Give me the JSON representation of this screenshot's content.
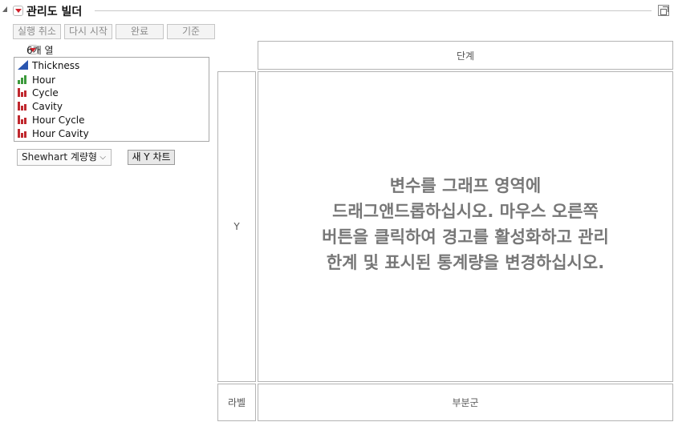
{
  "header": {
    "title": "관리도 빌더"
  },
  "toolbar": {
    "undo_label": "실행 취소",
    "restart_label": "다시 시작",
    "done_label": "완료",
    "criteria_label": "기준"
  },
  "columns": {
    "count_label": "6개 열",
    "items": [
      {
        "name": "Thickness",
        "icon": "continuous-icon"
      },
      {
        "name": "Hour",
        "icon": "ordinal-icon"
      },
      {
        "name": "Cycle",
        "icon": "nominal-icon"
      },
      {
        "name": "Cavity",
        "icon": "nominal-icon"
      },
      {
        "name": "Hour Cycle",
        "icon": "nominal-icon"
      },
      {
        "name": "Hour Cavity",
        "icon": "nominal-icon"
      }
    ]
  },
  "chart_type": {
    "selected": "Shewhart 계량형"
  },
  "new_y_chart_label": "새 Y 차트",
  "zones": {
    "phase": "단계",
    "y": "Y",
    "label": "라벨",
    "subgroup": "부분군",
    "instruction": [
      "변수를 그래프 영역에",
      "드래그앤드롭하십시오. 마우스 오른쪽",
      "버튼을 클릭하여 경고를 활성화하고 관리",
      "한계 및 표시된 통계량을 변경하십시오."
    ]
  },
  "colors": {
    "continuous_icon": "#2a56b0",
    "ordinal_icon": "#3c9a3c",
    "nominal_icon": "#c0282e",
    "menu_triangle": "#d0202a"
  }
}
